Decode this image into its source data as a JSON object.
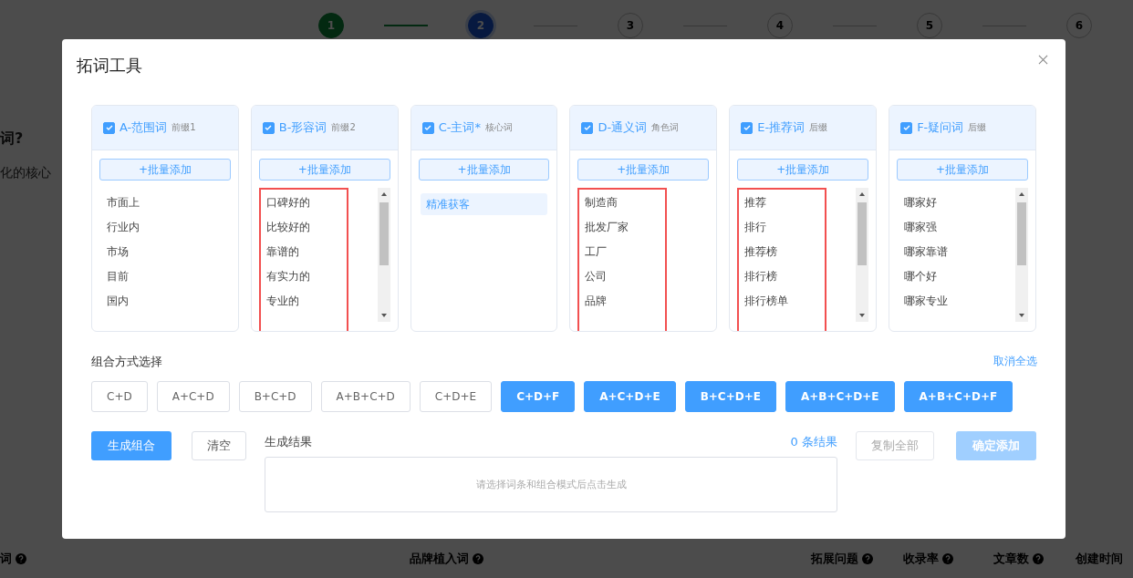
{
  "background_page": {
    "steps": [
      {
        "label": "1",
        "done": true,
        "selected": false
      },
      {
        "label": "2",
        "done": false,
        "selected": true
      },
      {
        "label": "3",
        "done": false,
        "selected": false
      },
      {
        "label": "4",
        "done": false,
        "selected": false
      },
      {
        "label": "5",
        "done": false,
        "selected": false
      },
      {
        "label": "6",
        "done": false,
        "selected": false
      }
    ],
    "question": "词?",
    "description": "化的核心",
    "table_headers": [
      {
        "label": "词",
        "help": true
      },
      {
        "label": "品牌植入词",
        "help": true
      },
      {
        "label": "拓展问题",
        "help": true
      },
      {
        "label": "收录率",
        "help": true
      },
      {
        "label": "文章数",
        "help": true
      },
      {
        "label": "创建时间",
        "help": false
      }
    ]
  },
  "dialog": {
    "title": "拓词工具",
    "columns": [
      {
        "title": "A-范围词",
        "tag": "前缀1",
        "checked": true,
        "add_button": "+批量添加",
        "highlighted": false,
        "scrollable": false,
        "items": [
          {
            "text": "市面上",
            "selected": false
          },
          {
            "text": "行业内",
            "selected": false
          },
          {
            "text": "市场",
            "selected": false
          },
          {
            "text": "目前",
            "selected": false
          },
          {
            "text": "国内",
            "selected": false
          }
        ]
      },
      {
        "title": "B-形容词",
        "tag": "前缀2",
        "checked": true,
        "add_button": "+批量添加",
        "highlighted": true,
        "scrollable": true,
        "items": [
          {
            "text": "口碑好的",
            "selected": false
          },
          {
            "text": "比较好的",
            "selected": false
          },
          {
            "text": "靠谱的",
            "selected": false
          },
          {
            "text": "有实力的",
            "selected": false
          },
          {
            "text": "专业的",
            "selected": false
          }
        ]
      },
      {
        "title": "C-主词*",
        "tag": "核心词",
        "checked": true,
        "add_button": "+批量添加",
        "highlighted": false,
        "scrollable": false,
        "items": [
          {
            "text": "精准获客",
            "selected": true
          }
        ]
      },
      {
        "title": "D-通义词",
        "tag": "角色词",
        "checked": true,
        "add_button": "+批量添加",
        "highlighted": true,
        "scrollable": false,
        "items": [
          {
            "text": "制造商",
            "selected": false
          },
          {
            "text": "批发厂家",
            "selected": false
          },
          {
            "text": "工厂",
            "selected": false
          },
          {
            "text": "公司",
            "selected": false
          },
          {
            "text": "品牌",
            "selected": false
          }
        ]
      },
      {
        "title": "E-推荐词",
        "tag": "后缀",
        "checked": true,
        "add_button": "+批量添加",
        "highlighted": true,
        "scrollable": true,
        "items": [
          {
            "text": "推荐",
            "selected": false
          },
          {
            "text": "排行",
            "selected": false
          },
          {
            "text": "推荐榜",
            "selected": false
          },
          {
            "text": "排行榜",
            "selected": false
          },
          {
            "text": "排行榜单",
            "selected": false
          }
        ]
      },
      {
        "title": "F-疑问词",
        "tag": "后缀",
        "checked": true,
        "add_button": "+批量添加",
        "highlighted": false,
        "scrollable": true,
        "items": [
          {
            "text": "哪家好",
            "selected": false
          },
          {
            "text": "哪家强",
            "selected": false
          },
          {
            "text": "哪家靠谱",
            "selected": false
          },
          {
            "text": "哪个好",
            "selected": false
          },
          {
            "text": "哪家专业",
            "selected": false
          }
        ]
      }
    ],
    "combination_label": "组合方式选择",
    "deselect_all": "取消全选",
    "combinations": [
      {
        "label": "C+D",
        "selected": false
      },
      {
        "label": "A+C+D",
        "selected": false
      },
      {
        "label": "B+C+D",
        "selected": false
      },
      {
        "label": "A+B+C+D",
        "selected": false
      },
      {
        "label": "C+D+E",
        "selected": false
      },
      {
        "label": "C+D+F",
        "selected": true
      },
      {
        "label": "A+C+D+E",
        "selected": true
      },
      {
        "label": "B+C+D+E",
        "selected": true
      },
      {
        "label": "A+B+C+D+E",
        "selected": true
      },
      {
        "label": "A+B+C+D+F",
        "selected": true
      }
    ],
    "generate_button": "生成组合",
    "clear_button": "清空",
    "result_label": "生成结果",
    "result_count": "0 条结果",
    "result_placeholder": "请选择词条和组合模式后点击生成",
    "copy_button": {
      "label": "复制全部",
      "disabled": true
    },
    "confirm_button": {
      "label": "确定添加",
      "disabled": true
    }
  }
}
